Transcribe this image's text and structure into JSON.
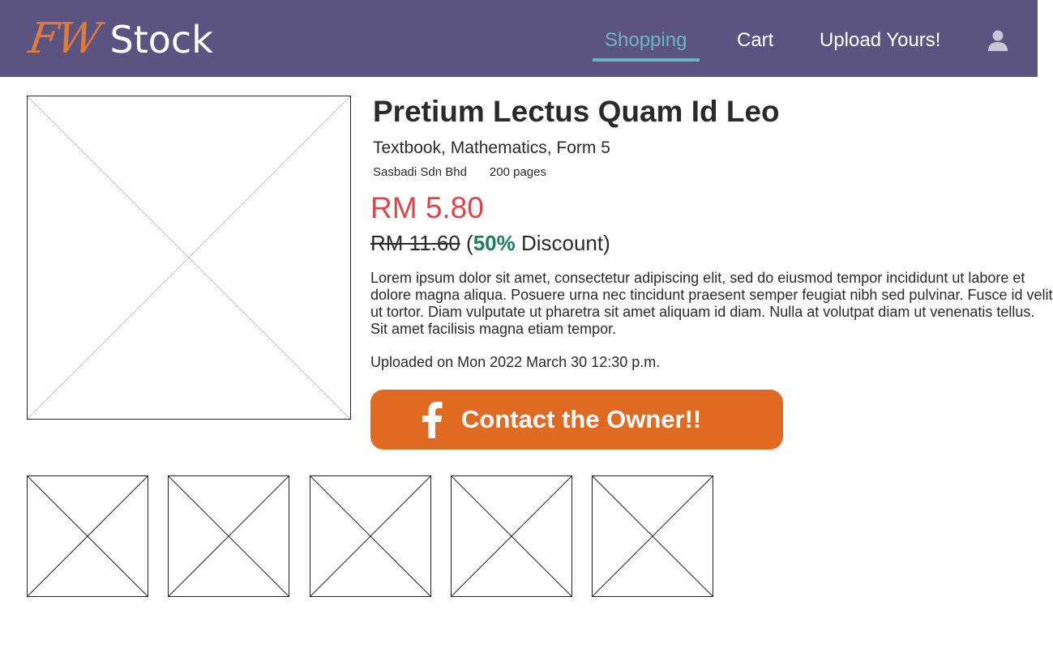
{
  "app": {
    "logo_mark": "FW",
    "logo_word": "Stock"
  },
  "nav": {
    "items": [
      {
        "label": "Shopping",
        "active": true
      },
      {
        "label": "Cart",
        "active": false
      },
      {
        "label": "Upload Yours!",
        "active": false
      }
    ],
    "user_icon": "user-icon"
  },
  "product": {
    "title": "Pretium Lectus Quam Id Leo",
    "subtitle": "Textbook, Mathematics, Form 5",
    "publisher": "Sasbadi Sdn Bhd",
    "pages": "200 pages",
    "price": "RM 5.80",
    "original_price": "RM 11.60",
    "discount_open": " (",
    "discount_pct": "50%",
    "discount_label": " Discount)",
    "description": "Lorem ipsum dolor sit amet, consectetur adipiscing elit, sed do eiusmod tempor incididunt ut labore et dolore magna aliqua. Posuere urna nec tincidunt praesent semper feugiat nibh sed pulvinar. Fusce id velit ut tortor. Diam vulputate ut pharetra sit amet aliquam id diam. Nulla at volutpat diam ut venenatis tellus. Sit amet facilisis magna etiam tempor.",
    "uploaded": "Uploaded on Mon 2022 March 30 12:30 p.m.",
    "contact_label": "Contact the Owner!!",
    "contact_icon": "facebook-icon"
  },
  "colors": {
    "header_bg": "#5b5380",
    "nav_active": "#6fb3c9",
    "price": "#d9464b",
    "discount": "#1a7f5c",
    "contact_button": "#e06a22",
    "logo_mark": "#e07a38"
  }
}
